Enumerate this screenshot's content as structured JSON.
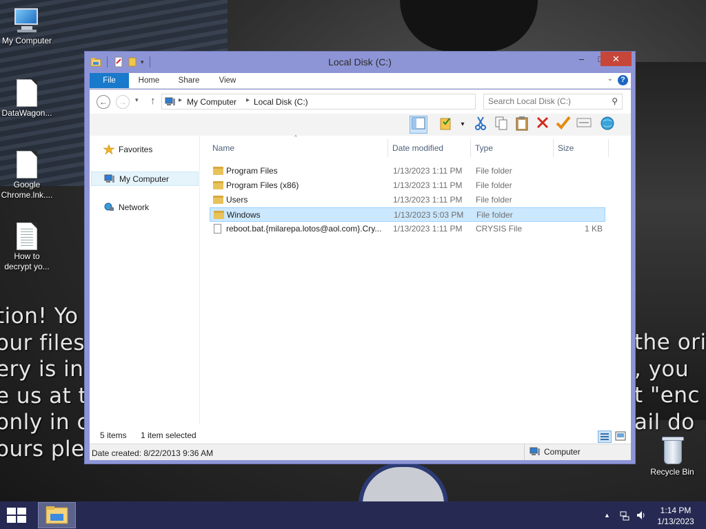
{
  "desktop": {
    "icons": [
      {
        "label": "My Computer"
      },
      {
        "label": "DataWagon..."
      },
      {
        "label": "Google Chrome.lnk...."
      },
      {
        "label": "How to decrypt yo..."
      },
      {
        "label": "Recycle Bin"
      }
    ],
    "wallpaper_text_left": "tion! Yo\nour files\nery is in\ne us at t\nonly in c\nours plea",
    "wallpaper_text_right": "the ori\n, you\nt \"enc\nail do"
  },
  "window": {
    "title": "Local Disk (C:)",
    "controls": {
      "minimize": "–",
      "maximize": "□",
      "close": "✕"
    },
    "ribbon_tabs": [
      "File",
      "Home",
      "Share",
      "View"
    ],
    "address": {
      "segments": [
        "My Computer",
        "Local Disk (C:)"
      ]
    },
    "search": {
      "placeholder": "Search Local Disk (C:)"
    },
    "nav_pane": {
      "items": [
        {
          "label": "Favorites",
          "icon": "star-icon"
        },
        {
          "label": "My Computer",
          "icon": "computer-icon",
          "selected": true
        },
        {
          "label": "Network",
          "icon": "network-icon"
        }
      ]
    },
    "columns": [
      "Name",
      "Date modified",
      "Type",
      "Size"
    ],
    "files": [
      {
        "name": "Program Files",
        "date": "1/13/2023 1:11 PM",
        "type": "File folder",
        "size": "",
        "kind": "folder"
      },
      {
        "name": "Program Files (x86)",
        "date": "1/13/2023 1:11 PM",
        "type": "File folder",
        "size": "",
        "kind": "folder"
      },
      {
        "name": "Users",
        "date": "1/13/2023 1:11 PM",
        "type": "File folder",
        "size": "",
        "kind": "folder"
      },
      {
        "name": "Windows",
        "date": "1/13/2023 5:03 PM",
        "type": "File folder",
        "size": "",
        "kind": "folder",
        "selected": true
      },
      {
        "name": "reboot.bat.{milarepa.lotos@aol.com}.Cry...",
        "date": "1/13/2023 1:11 PM",
        "type": "CRYSIS File",
        "size": "1 KB",
        "kind": "file"
      }
    ],
    "status": {
      "item_count": "5 items",
      "selection": "1 item selected",
      "date_created": "Date created: 8/22/2013 9:36 AM",
      "zone": "Computer"
    }
  },
  "taskbar": {
    "time": "1:14 PM",
    "date": "1/13/2023"
  },
  "colors": {
    "window_frame": "#8e95d6",
    "file_tab": "#1979ca",
    "selection": "#cce8ff",
    "taskbar": "#262a52",
    "close_button": "#c7463a"
  }
}
